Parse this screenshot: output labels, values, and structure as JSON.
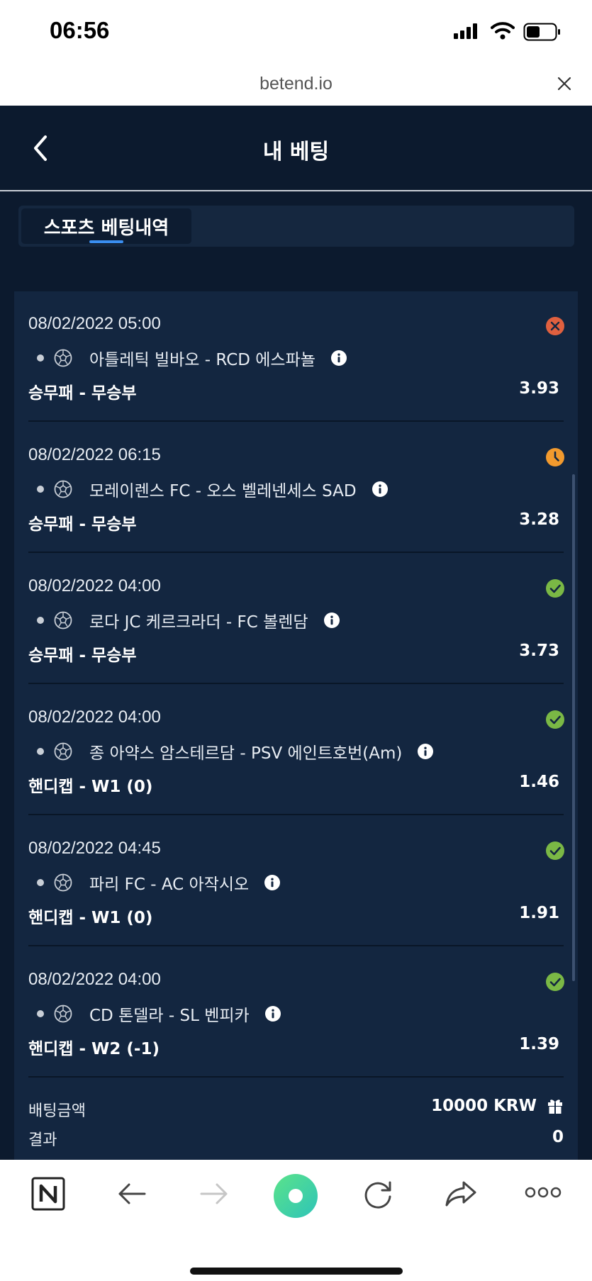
{
  "status": {
    "time": "06:56"
  },
  "browser": {
    "url": "betend.io"
  },
  "header": {
    "title": "내 베팅"
  },
  "tabs": [
    {
      "label": "스포츠 베팅내역"
    }
  ],
  "bets": [
    {
      "date": "08/02/2022 05:00",
      "status": "lost",
      "match": "아틀레틱 빌바오 - RCD 에스파뇰",
      "market": "승무패 - 무승부",
      "odd": "3.93"
    },
    {
      "date": "08/02/2022 06:15",
      "status": "pending",
      "match": "모레이렌스 FC - 오스 벨레넨세스 SAD",
      "market": "승무패 - 무승부",
      "odd": "3.28"
    },
    {
      "date": "08/02/2022 04:00",
      "status": "won",
      "match": "로다 JC 케르크라더 - FC 볼렌담",
      "market": "승무패 - 무승부",
      "odd": "3.73"
    },
    {
      "date": "08/02/2022 04:00",
      "status": "won",
      "match": "종 아약스 암스테르담 - PSV 에인트호번(Am)",
      "market": "핸디캡 - W1 (0)",
      "odd": "1.46"
    },
    {
      "date": "08/02/2022 04:45",
      "status": "won",
      "match": "파리 FC - AC 아작시오",
      "market": "핸디캡 - W1 (0)",
      "odd": "1.91"
    },
    {
      "date": "08/02/2022 04:00",
      "status": "won",
      "match": "CD 톤델라 - SL 벤피카",
      "market": "핸디캡 - W2 (-1)",
      "odd": "1.39"
    }
  ],
  "summary": {
    "stake_label": "배팅금액",
    "stake_value": "10000 KRW",
    "result_label": "결과",
    "result_value": "0"
  },
  "colors": {
    "lost": "#e0603f",
    "pending": "#f29a2e",
    "won": "#7ab845",
    "accent": "#3a8ef0",
    "background": "#0c1a2e"
  },
  "toolbar_icons": [
    "naver-n-icon",
    "back-arrow-icon",
    "forward-arrow-icon",
    "green-circle-icon",
    "reload-icon",
    "share-icon",
    "more-icon"
  ]
}
